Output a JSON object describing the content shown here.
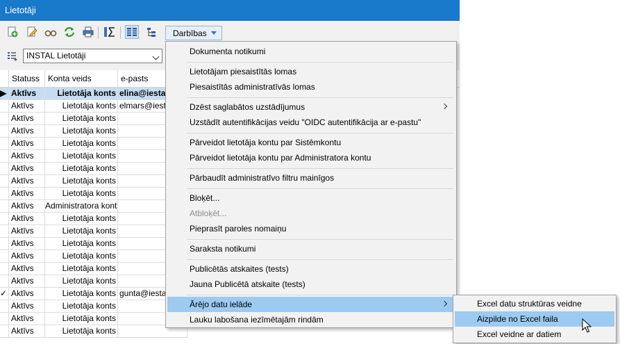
{
  "window": {
    "title": "Lietotāji"
  },
  "toolbar": {
    "icons": [
      "add-icon",
      "edit-icon",
      "view-icon",
      "refresh-icon",
      "print-icon",
      "sum-icon",
      "columns-icon",
      "tree-icon"
    ],
    "actions_label": "Darbības"
  },
  "filter": {
    "value": "INSTAL Lietotāji"
  },
  "grid": {
    "columns": [
      "Statuss",
      "Konta veids",
      "e-pasts"
    ],
    "rows": [
      {
        "marker": "▶",
        "status": "Aktīvs",
        "type": "Lietotāja konts",
        "email": "elina@iestad"
      },
      {
        "marker": "",
        "status": "Aktīvs",
        "type": "Lietotāja konts",
        "email": "elmars@iestad"
      },
      {
        "marker": "",
        "status": "Aktīvs",
        "type": "Lietotāja konts",
        "email": ""
      },
      {
        "marker": "",
        "status": "Aktīvs",
        "type": "Lietotāja konts",
        "email": ""
      },
      {
        "marker": "",
        "status": "Aktīvs",
        "type": "Lietotāja konts",
        "email": ""
      },
      {
        "marker": "",
        "status": "Aktīvs",
        "type": "Lietotāja konts",
        "email": ""
      },
      {
        "marker": "",
        "status": "Aktīvs",
        "type": "Lietotāja konts",
        "email": ""
      },
      {
        "marker": "",
        "status": "Aktīvs",
        "type": "Lietotāja konts",
        "email": ""
      },
      {
        "marker": "",
        "status": "Aktīvs",
        "type": "Lietotāja konts",
        "email": ""
      },
      {
        "marker": "",
        "status": "Aktīvs",
        "type": "Administratora konts",
        "email": ""
      },
      {
        "marker": "",
        "status": "Aktīvs",
        "type": "Lietotāja konts",
        "email": ""
      },
      {
        "marker": "",
        "status": "Aktīvs",
        "type": "Lietotāja konts",
        "email": ""
      },
      {
        "marker": "",
        "status": "Aktīvs",
        "type": "Lietotāja konts",
        "email": ""
      },
      {
        "marker": "",
        "status": "Aktīvs",
        "type": "Lietotāja konts",
        "email": ""
      },
      {
        "marker": "",
        "status": "Aktīvs",
        "type": "Lietotāja konts",
        "email": ""
      },
      {
        "marker": "",
        "status": "Aktīvs",
        "type": "Lietotāja konts",
        "email": ""
      },
      {
        "marker": "✓",
        "status": "Aktīvs",
        "type": "Lietotāja konts",
        "email": "gunta@iestad"
      },
      {
        "marker": "",
        "status": "Aktīvs",
        "type": "Lietotāja konts",
        "email": ""
      },
      {
        "marker": "",
        "status": "Aktīvs",
        "type": "Lietotāja konts",
        "email": ""
      },
      {
        "marker": "",
        "status": "Aktīvs",
        "type": "Lietotāja konts",
        "email": ""
      }
    ]
  },
  "menu": {
    "items": [
      {
        "label": "Dokumenta notikumi"
      },
      {
        "label": "Lietotājam piesaistītās lomas"
      },
      {
        "label": "Piesaistītās administratīvās lomas"
      },
      {
        "label": "Dzēst saglabātos uzstādījumus"
      },
      {
        "label": "Uzstādīt autentifikācijas veidu \"OIDC autentifikācija ar e-pastu\""
      },
      {
        "label": "Pārveidot lietotāja kontu par Sistēmkontu"
      },
      {
        "label": "Pārveidot lietotāja kontu par Administratora kontu"
      },
      {
        "label": "Pārbaudīt administratīvo filtru mainīgos"
      },
      {
        "label": "Bloķēt..."
      },
      {
        "label": "Atbloķēt..."
      },
      {
        "label": "Pieprasīt paroles nomaiņu"
      },
      {
        "label": "Saraksta notikumi"
      },
      {
        "label": "Publicētās atskaites (tests)"
      },
      {
        "label": "Jauna Publicētā atskaite (tests)"
      },
      {
        "label": "Ārējo datu ielāde"
      },
      {
        "label": "Lauku labošana iezīmētajām rindām"
      }
    ]
  },
  "submenu": {
    "items": [
      {
        "label": "Excel datu struktūras veidne"
      },
      {
        "label": "Aizpilde no Excel faila"
      },
      {
        "label": "Excel veidne ar datiem"
      }
    ]
  }
}
